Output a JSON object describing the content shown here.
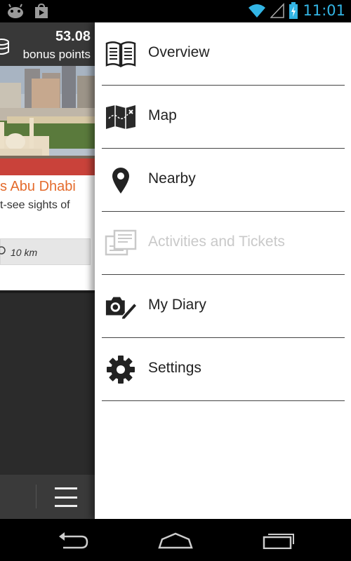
{
  "status_bar": {
    "time": "11:01"
  },
  "background_screen": {
    "bonus_points_value": "53.08",
    "bonus_points_label": "bonus points",
    "card_title": "s Abu Dhabi",
    "card_description": "t-see sights of",
    "distance": "10 km"
  },
  "drawer": {
    "items": [
      {
        "label": "Overview",
        "icon": "book-icon",
        "enabled": true
      },
      {
        "label": "Map",
        "icon": "map-icon",
        "enabled": true
      },
      {
        "label": "Nearby",
        "icon": "location-pin-icon",
        "enabled": true
      },
      {
        "label": "Activities and Tickets",
        "icon": "tickets-icon",
        "enabled": false
      },
      {
        "label": "My Diary",
        "icon": "camera-pencil-icon",
        "enabled": true
      },
      {
        "label": "Settings",
        "icon": "gear-icon",
        "enabled": true
      }
    ]
  },
  "colors": {
    "accent": "#33b5e5",
    "title_orange": "#e46b2c",
    "disabled_text": "#c9c9c9"
  }
}
